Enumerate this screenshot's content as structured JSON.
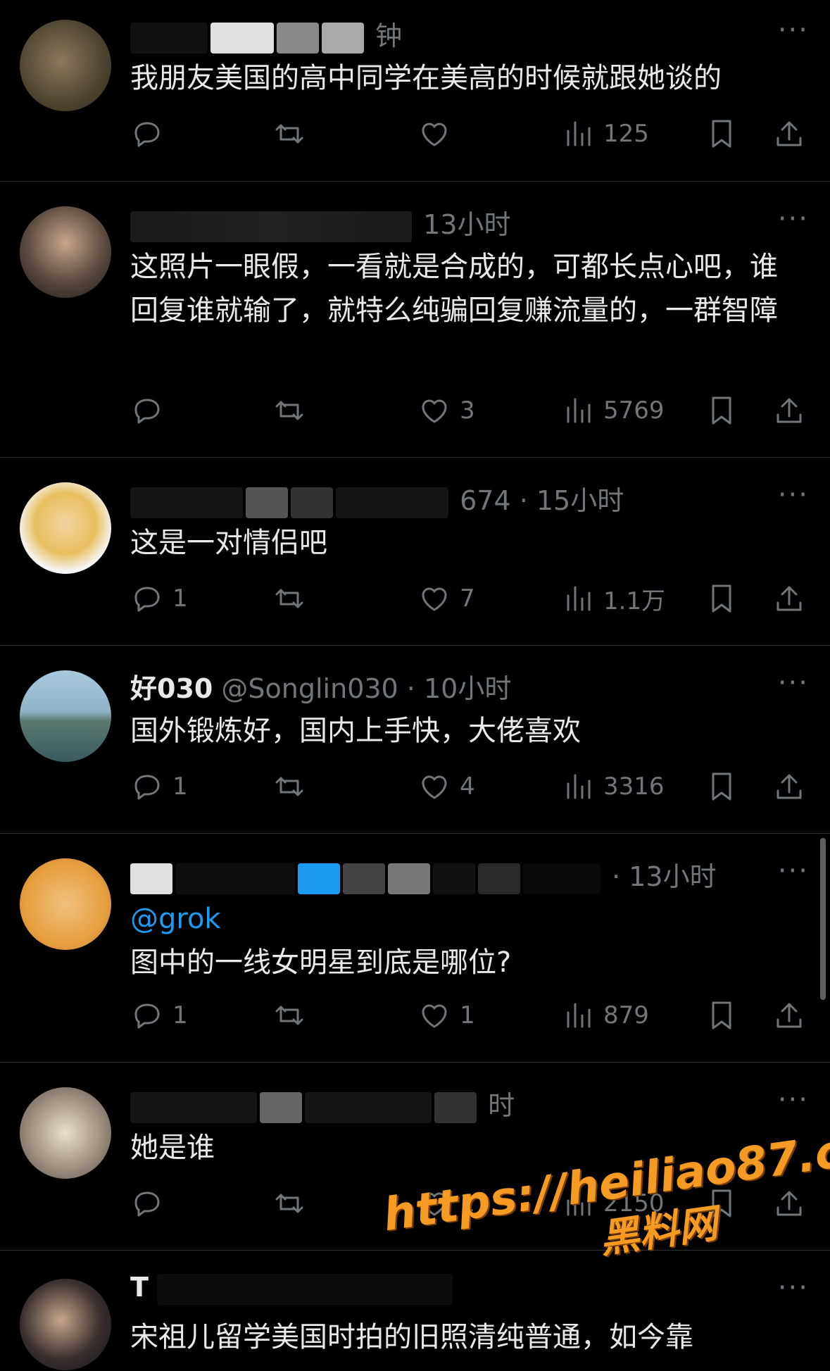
{
  "posts": [
    {
      "name": "",
      "handle_time": "钟",
      "text": "我朋友美国的高中同学在美高的时候就跟她谈的",
      "actions": {
        "reply": "",
        "repost": "",
        "like": "",
        "views": "125"
      }
    },
    {
      "name": "",
      "handle_time": "13小时",
      "text": "这照片一眼假，一看就是合成的，可都长点心吧，谁回复谁就输了，就特么纯骗回复赚流量的，一群智障",
      "actions": {
        "reply": "",
        "repost": "",
        "like": "3",
        "views": "5769"
      }
    },
    {
      "name": "",
      "handle_time": "674 · 15小时",
      "text": "这是一对情侣吧",
      "actions": {
        "reply": "1",
        "repost": "",
        "like": "7",
        "views": "1.1万"
      }
    },
    {
      "name": "好030",
      "handle_time": "@Songlin030 · 10小时",
      "text": "国外锻炼好，国内上手快，大佬喜欢",
      "actions": {
        "reply": "1",
        "repost": "",
        "like": "4",
        "views": "3316"
      }
    },
    {
      "name": "",
      "handle_time": "· 13小时",
      "mention": "@grok",
      "text": "图中的一线女明星到底是哪位?",
      "actions": {
        "reply": "1",
        "repost": "",
        "like": "1",
        "views": "879"
      }
    },
    {
      "name": "",
      "handle_time": "时",
      "text": "她是谁",
      "actions": {
        "reply": "",
        "repost": "",
        "like": "1",
        "views": "2150"
      }
    },
    {
      "name": "T",
      "handle_time": "",
      "text": "宋祖儿留学美国时拍的旧照清纯普通，如今靠",
      "actions": {
        "reply": "",
        "repost": "",
        "like": "",
        "views": ""
      }
    }
  ],
  "more_label": "···",
  "watermark": {
    "url": "https://heiliao87.com",
    "sub": "黑料网"
  },
  "colors": {
    "background": "#000000",
    "text": "#e7e9ea",
    "muted": "#71767b",
    "accent": "#1d9bf0",
    "watermark": "#f59a23"
  },
  "icons": [
    "reply-icon",
    "repost-icon",
    "like-icon",
    "views-icon",
    "bookmark-icon",
    "share-icon",
    "more-icon"
  ]
}
